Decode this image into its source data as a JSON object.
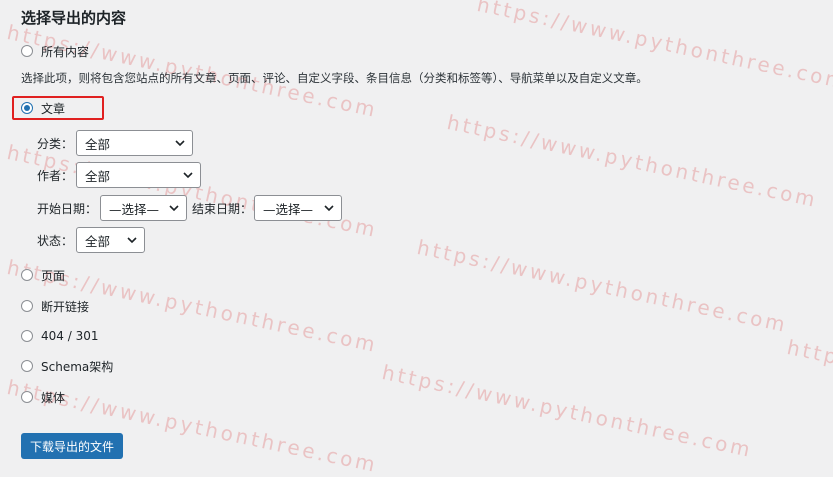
{
  "section_title": "选择导出的内容",
  "options": {
    "all": "所有内容",
    "description": "选择此项，则将包含您站点的所有文章、页面、评论、自定义字段、条目信息（分类和标签等）、导航菜单以及自定义文章。",
    "posts": "文章",
    "pages": "页面",
    "broken_links": "断开链接",
    "redirects": "404 / 301",
    "schema": "Schema架构",
    "media": "媒体"
  },
  "filters": {
    "category_label": "分类：",
    "category_value": "全部",
    "author_label": "作者：",
    "author_value": "全部",
    "start_date_label": "开始日期：",
    "start_date_value": "—选择—",
    "end_date_label": "结束日期：",
    "end_date_value": "—选择—",
    "status_label": "状态：",
    "status_value": "全部"
  },
  "download_button": "下载导出的文件",
  "watermark": "https://www.pythonthree.com",
  "colors": {
    "accent": "#2271b1",
    "highlight_box": "#e02020",
    "watermark": "#dc5050"
  }
}
